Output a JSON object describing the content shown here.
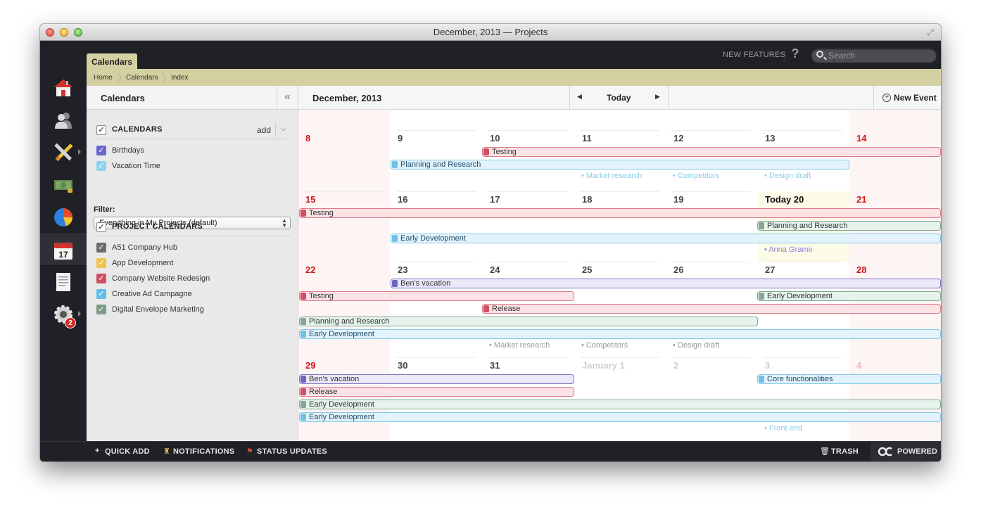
{
  "window": {
    "title": "December, 2013 — Projects"
  },
  "topbar": {
    "tab_label": "Calendars",
    "new_features_label": "NEW FEATURES",
    "help_label": "?",
    "search_placeholder": "Search"
  },
  "breadcrumb": [
    "Home",
    "Calendars",
    "Index"
  ],
  "leftnav": {
    "items": [
      {
        "name": "home-icon"
      },
      {
        "name": "people-icon"
      },
      {
        "name": "tools-icon"
      },
      {
        "name": "money-icon"
      },
      {
        "name": "pie-chart-icon"
      },
      {
        "name": "calendar-icon",
        "label": "17",
        "active": true
      },
      {
        "name": "document-icon"
      },
      {
        "name": "settings-icon",
        "badge": "2"
      }
    ]
  },
  "sidebar": {
    "title": "Calendars",
    "calendars_section": {
      "title": "CALENDARS",
      "add_label": "add",
      "items": [
        {
          "label": "Birthdays",
          "color": "#6b66c9"
        },
        {
          "label": "Vacation Time",
          "color": "#8fd3ec"
        }
      ]
    },
    "filter": {
      "label": "Filter:",
      "selected": "Everything in My Projects (default)"
    },
    "project_section": {
      "title": "PROJECT CALENDARS",
      "items": [
        {
          "label": "A51 Company Hub",
          "color": "#6d6d6d"
        },
        {
          "label": "App Development",
          "color": "#f1c34c"
        },
        {
          "label": "Company Website Redesign",
          "color": "#cf5060"
        },
        {
          "label": "Creative Ad Campagne",
          "color": "#5fbfe8"
        },
        {
          "label": "Digital Envelope Marketing",
          "color": "#7d9a86"
        }
      ]
    }
  },
  "calendar": {
    "month_title": "December, 2013",
    "today_label": "Today",
    "new_event_label": "New Event",
    "weeks": [
      {
        "days": [
          "8",
          "9",
          "10",
          "11",
          "12",
          "13",
          "14"
        ]
      },
      {
        "days": [
          "15",
          "16",
          "17",
          "18",
          "19",
          "Today 20",
          "21"
        ]
      },
      {
        "days": [
          "22",
          "23",
          "24",
          "25",
          "26",
          "27",
          "28"
        ]
      },
      {
        "days": [
          "29",
          "30",
          "31",
          "January 1",
          "2",
          "3",
          "4"
        ]
      }
    ],
    "events": [
      {
        "label": "Testing",
        "color": "pink"
      },
      {
        "label": "Planning and Research",
        "color": "blue"
      },
      {
        "label": "Testing",
        "color": "pink"
      },
      {
        "label": "Planning and Research",
        "color": "green"
      },
      {
        "label": "Early Development",
        "color": "blue"
      },
      {
        "label": "Ben's vacation",
        "color": "purple"
      },
      {
        "label": "Testing",
        "color": "pink"
      },
      {
        "label": "Early Development",
        "color": "green"
      },
      {
        "label": "Release",
        "color": "pink"
      },
      {
        "label": "Planning and Research",
        "color": "green"
      },
      {
        "label": "Early Development",
        "color": "blue"
      },
      {
        "label": "Ben's vacation",
        "color": "purple"
      },
      {
        "label": "Core functionalities",
        "color": "blue"
      },
      {
        "label": "Release",
        "color": "pink"
      },
      {
        "label": "Early Development",
        "color": "green"
      },
      {
        "label": "Early Development",
        "color": "blue"
      }
    ],
    "mini_items": [
      {
        "label": "• Market research",
        "color": "blue"
      },
      {
        "label": "• Competitors",
        "color": "blue"
      },
      {
        "label": "• Design draft",
        "color": "blue"
      },
      {
        "label": "• Anna Grame",
        "color": "purple"
      },
      {
        "label": "• Market research",
        "color": "grey"
      },
      {
        "label": "• Competitors",
        "color": "grey"
      },
      {
        "label": "• Design draft",
        "color": "grey"
      },
      {
        "label": "• Front end",
        "color": "blue"
      }
    ]
  },
  "bottombar": {
    "quick_add": "QUICK ADD",
    "notifications": "NOTIFICATIONS",
    "status_updates": "STATUS UPDATES",
    "trash": "TRASH",
    "powered": "POWERED"
  }
}
